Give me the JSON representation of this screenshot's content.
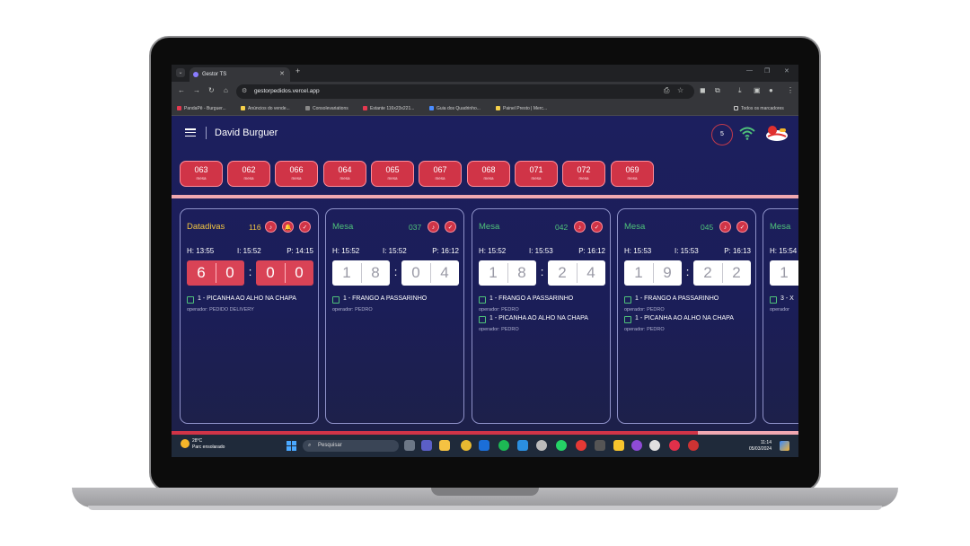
{
  "browser": {
    "tab_title": "Gestor TS",
    "url": "gestorpedidos.vercel.app",
    "bookmarks": [
      "PandaPê - Burguer...",
      "Anúncios do vende...",
      "Consolevariations",
      "Estante 116x23x221...",
      "Guia dos Quadrinho...",
      "Painel Presto | Merc..."
    ],
    "all_bookmarks": "Todos os marcadores"
  },
  "header": {
    "title": "David Burguer",
    "badge_count": "5"
  },
  "pending_orders": [
    {
      "number": "063",
      "label": "mesa"
    },
    {
      "number": "062",
      "label": "mesa"
    },
    {
      "number": "066",
      "label": "mesa"
    },
    {
      "number": "064",
      "label": "mesa"
    },
    {
      "number": "065",
      "label": "mesa"
    },
    {
      "number": "067",
      "label": "mesa"
    },
    {
      "number": "068",
      "label": "mesa"
    },
    {
      "number": "071",
      "label": "mesa"
    },
    {
      "number": "072",
      "label": "mesa"
    },
    {
      "number": "069",
      "label": "mesa"
    }
  ],
  "orders": [
    {
      "type": "Datadivas",
      "number": "116",
      "h": "H: 13:55",
      "i": "I: 15:52",
      "p": "P: 14:15",
      "timer": [
        "6",
        "0",
        "0",
        "0"
      ],
      "items": [
        {
          "text": "1 - PICANHA AO ALHO NA CHAPA",
          "operator": "operador: PEDIDO DELIVERY"
        }
      ]
    },
    {
      "type": "Mesa",
      "number": "037",
      "h": "H: 15:52",
      "i": "I: 15:52",
      "p": "P: 16:12",
      "timer": [
        "1",
        "8",
        "0",
        "4"
      ],
      "items": [
        {
          "text": "1 - FRANGO A PASSARINHO",
          "operator": "operador: PEDRO"
        }
      ]
    },
    {
      "type": "Mesa",
      "number": "042",
      "h": "H: 15:52",
      "i": "I: 15:53",
      "p": "P: 16:12",
      "timer": [
        "1",
        "8",
        "2",
        "4"
      ],
      "items": [
        {
          "text": "1 - FRANGO A PASSARINHO",
          "operator": "operador: PEDRO"
        },
        {
          "text": "1 - PICANHA AO ALHO NA CHAPA",
          "operator": "operador: PEDRO"
        }
      ]
    },
    {
      "type": "Mesa",
      "number": "045",
      "h": "H: 15:53",
      "i": "I: 15:53",
      "p": "P: 16:13",
      "timer": [
        "1",
        "9",
        "2",
        "2"
      ],
      "items": [
        {
          "text": "1 - FRANGO A PASSARINHO",
          "operator": "operador: PEDRO"
        },
        {
          "text": "1 - PICANHA AO ALHO NA CHAPA",
          "operator": "operador: PEDRO"
        }
      ]
    },
    {
      "type": "Mesa",
      "number": "",
      "h": "H: 15:54",
      "i": "",
      "p": "",
      "timer": [
        "1",
        "",
        "",
        ""
      ],
      "items": [
        {
          "text": "3 - X",
          "operator": "operador"
        }
      ]
    }
  ],
  "progress": 0.84,
  "taskbar": {
    "temp": "28°C",
    "weather": "Parc ensolarado",
    "search": "Pesquisar",
    "time": "11:14",
    "date": "05/03/2024"
  },
  "colors": {
    "accent_red": "#d03447",
    "datadivas_title": "#f2c542",
    "mesa_title": "#4fc27a",
    "background": "#1c1f5e"
  }
}
